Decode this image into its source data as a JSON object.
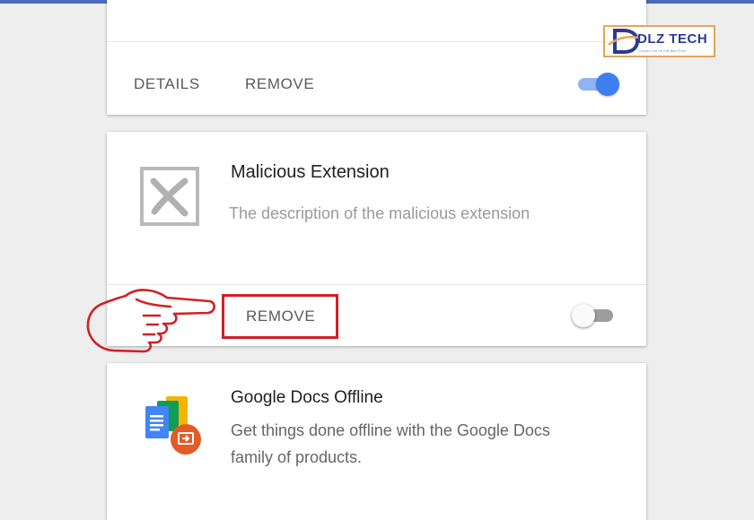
{
  "extensions": [
    {
      "details_label": "DETAILS",
      "remove_label": "REMOVE",
      "enabled": true
    },
    {
      "title": "Malicious Extension",
      "description": "The description of the malicious extension",
      "remove_label": "REMOVE",
      "enabled": false,
      "icon": "broken-x-icon"
    },
    {
      "title": "Google Docs Offline",
      "description_line1": "Get things done offline with the Google Docs",
      "description_line2": "family of products.",
      "icon": "google-docs-offline-icon"
    }
  ],
  "annotation": {
    "highlight_color": "#d12026",
    "pointer": "pointing-hand-icon"
  },
  "watermark": {
    "brand": "DLZ TECH",
    "tagline": "Chuyên Gia Về Cắt Bàn Phím"
  },
  "colors": {
    "toggle_on": "#3d7ef0",
    "toggle_on_track": "#8fb3f5",
    "accent_bar": "#4a6bbf"
  }
}
